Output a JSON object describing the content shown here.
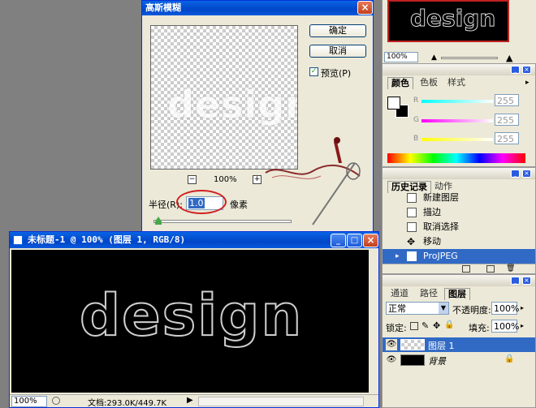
{
  "gauss_dialog": {
    "title": "高斯模糊",
    "ok_label": "确定",
    "cancel_label": "取消",
    "preview_label": "预览(P)",
    "preview_checked": true,
    "zoom_label": "100%",
    "zoom_minus": "−",
    "zoom_plus": "+",
    "radius_label": "半径(R):",
    "radius_value": "1.0",
    "radius_unit": "像素",
    "preview_text": "design",
    "radius_slider_level": 0.02
  },
  "document": {
    "title": "未标题-1 @ 100% (图层 1, RGB/8)",
    "text": "design",
    "zoom": "100%",
    "doc_info": "文档:293.0K/449.7K"
  },
  "navigator": {
    "text": "design",
    "zoom": "100%"
  },
  "color_panel": {
    "tabs": [
      "颜色",
      "色板",
      "样式"
    ],
    "r_label": "R",
    "g_label": "G",
    "b_label": "B",
    "r_value": "255",
    "g_value": "255",
    "b_value": "255",
    "colors": {
      "r": "#ff4040",
      "g": "#40c040",
      "b": "#4040ff"
    }
  },
  "history_panel": {
    "tabs": [
      "历史记录",
      "动作"
    ],
    "items": [
      "新建图层",
      "描边",
      "取消选择",
      "移动",
      "ProJPEG"
    ]
  },
  "layers_panel": {
    "tabs": [
      "通道",
      "路径",
      "图层"
    ],
    "blend_mode": "正常",
    "opacity_label": "不透明度:",
    "opacity_value": "100%",
    "lock_label": "锁定:",
    "fill_label": "填充:",
    "fill_value": "100%",
    "layers": [
      {
        "name": "图层 1",
        "selected": true
      },
      {
        "name": "背景",
        "selected": false
      }
    ]
  }
}
